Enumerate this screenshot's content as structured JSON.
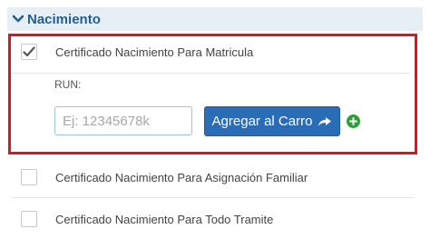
{
  "section": {
    "title": "Nacimiento"
  },
  "items": [
    {
      "label": "Certificado Nacimiento Para Matricula",
      "checked": true
    },
    {
      "label": "Certificado Nacimiento Para Asignación Familiar",
      "checked": false
    },
    {
      "label": "Certificado Nacimiento Para Todo Tramite",
      "checked": false
    }
  ],
  "run": {
    "label": "RUN:",
    "placeholder": "Ej: 12345678k",
    "value": ""
  },
  "buttons": {
    "add_to_cart": "Agregar al Carro"
  },
  "icons": {
    "section_toggle": "chevron-down-icon",
    "checked": "checkmark-icon",
    "add_arrow": "share-arrow-icon",
    "add_more": "plus-circle-icon"
  },
  "colors": {
    "header_text": "#1f5f94",
    "header_bg": "#e7eff6",
    "highlight_border": "#e3121b",
    "button_bg": "#2a6cb5",
    "plus_bg": "#2f9e3a"
  }
}
